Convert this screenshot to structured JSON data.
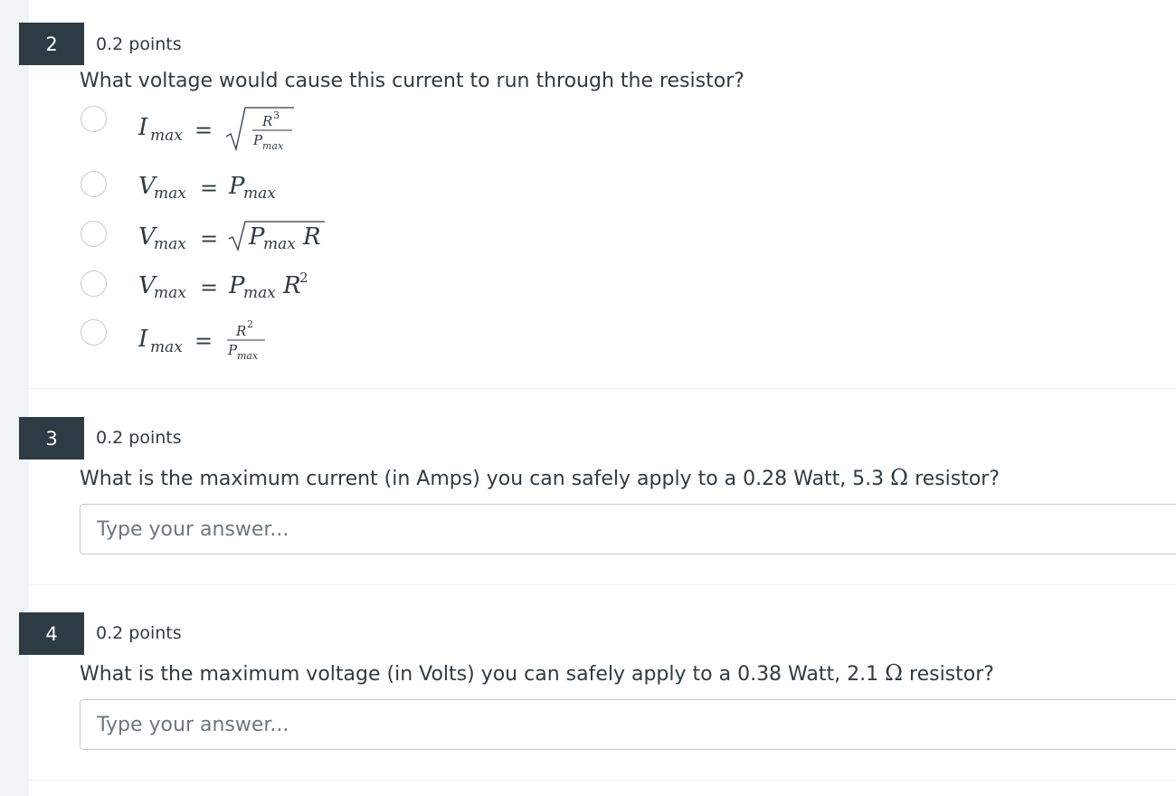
{
  "questions": [
    {
      "number": "2",
      "points": "0.2 points",
      "prompt": "What voltage would cause this current to run through the resistor?",
      "options": [
        {
          "lhs": "I",
          "lhs_sub": "max",
          "rhs": "sqrt(R^3 / P_max)"
        },
        {
          "lhs": "V",
          "lhs_sub": "max",
          "rhs": "P_max"
        },
        {
          "lhs": "V",
          "lhs_sub": "max",
          "rhs": "sqrt(P_max R)"
        },
        {
          "lhs": "V",
          "lhs_sub": "max",
          "rhs": "P_max R^2"
        },
        {
          "lhs": "I",
          "lhs_sub": "max",
          "rhs": "R^2 / P_max"
        }
      ]
    },
    {
      "number": "3",
      "points": "0.2 points",
      "prompt_before": "What is the maximum current (in Amps) you can safely apply to a 0.28 Watt, 5.3 ",
      "prompt_symbol": "Ω",
      "prompt_after": " resistor?",
      "answer_placeholder": "Type your answer...",
      "answer_value": ""
    },
    {
      "number": "4",
      "points": "0.2 points",
      "prompt_before": "What is the maximum voltage (in Volts) you can safely apply to a 0.38 Watt, 2.1 ",
      "prompt_symbol": "Ω",
      "prompt_after": " resistor?",
      "answer_placeholder": "Type your answer...",
      "answer_value": ""
    }
  ],
  "colors": {
    "badge_bg": "#2d3b45",
    "text": "#2d3b45",
    "border": "#c7cdd1",
    "divider": "#eef0f1"
  }
}
